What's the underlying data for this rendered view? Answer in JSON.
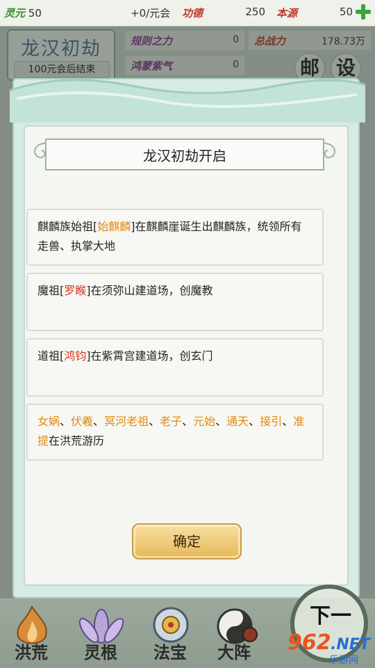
{
  "top_bar": {
    "resources": [
      {
        "label": "灵元",
        "value": "50"
      },
      {
        "label": "",
        "value": "+0/元会"
      },
      {
        "label": "功德",
        "value": "250"
      },
      {
        "label": "本源",
        "value": "50"
      }
    ]
  },
  "era": {
    "title": "龙汉初劫",
    "subtitle": "100元会后结束"
  },
  "stats": [
    {
      "label": "规则之力",
      "value": "0"
    },
    {
      "label": "总战力",
      "value": "178.73万"
    },
    {
      "label": "鸿蒙紫气",
      "value": "0"
    }
  ],
  "side_buttons": {
    "mail": "邮",
    "settings": "设"
  },
  "dialog": {
    "title": "龙汉初劫开启",
    "events": [
      {
        "segments": [
          {
            "text": "麒麟族始祖[",
            "tone": "normal"
          },
          {
            "text": "始麒麟",
            "tone": "orange"
          },
          {
            "text": "]在麒麟崖诞生出麒麟族，统领所有走兽、执掌大地",
            "tone": "normal"
          }
        ]
      },
      {
        "segments": [
          {
            "text": "魔祖[",
            "tone": "normal"
          },
          {
            "text": "罗睺",
            "tone": "red"
          },
          {
            "text": "]在须弥山建道场，创魔教",
            "tone": "normal"
          }
        ]
      },
      {
        "segments": [
          {
            "text": "道祖[",
            "tone": "normal"
          },
          {
            "text": "鸿钧",
            "tone": "red"
          },
          {
            "text": "]在紫霄宫建道场，创玄门",
            "tone": "normal"
          }
        ]
      },
      {
        "segments": [
          {
            "text": "女娲",
            "tone": "orange"
          },
          {
            "text": "、",
            "tone": "normal"
          },
          {
            "text": "伏羲",
            "tone": "orange"
          },
          {
            "text": "、",
            "tone": "normal"
          },
          {
            "text": "冥河老祖",
            "tone": "orange"
          },
          {
            "text": "、",
            "tone": "normal"
          },
          {
            "text": "老子",
            "tone": "orange"
          },
          {
            "text": "、",
            "tone": "normal"
          },
          {
            "text": "元始",
            "tone": "orange"
          },
          {
            "text": "、",
            "tone": "normal"
          },
          {
            "text": "通天",
            "tone": "orange"
          },
          {
            "text": "、",
            "tone": "normal"
          },
          {
            "text": "接引",
            "tone": "orange"
          },
          {
            "text": "、",
            "tone": "normal"
          },
          {
            "text": "准提",
            "tone": "orange"
          },
          {
            "text": "在洪荒游历",
            "tone": "normal"
          }
        ]
      }
    ],
    "confirm_label": "确定"
  },
  "bottom_nav": [
    {
      "label": "洪荒",
      "icon": "flame-icon"
    },
    {
      "label": "灵根",
      "icon": "lotus-icon"
    },
    {
      "label": "法宝",
      "icon": "treasure-icon"
    },
    {
      "label": "大阵",
      "icon": "formation-icon"
    }
  ],
  "next_button": {
    "label": "下一"
  },
  "watermark": {
    "logo": "962",
    "net": ".NET",
    "sub": "乐游网"
  },
  "colors": {
    "highlight_orange": "#e08a12",
    "highlight_red": "#d8361e",
    "confirm_gold": "#e6b85a"
  }
}
